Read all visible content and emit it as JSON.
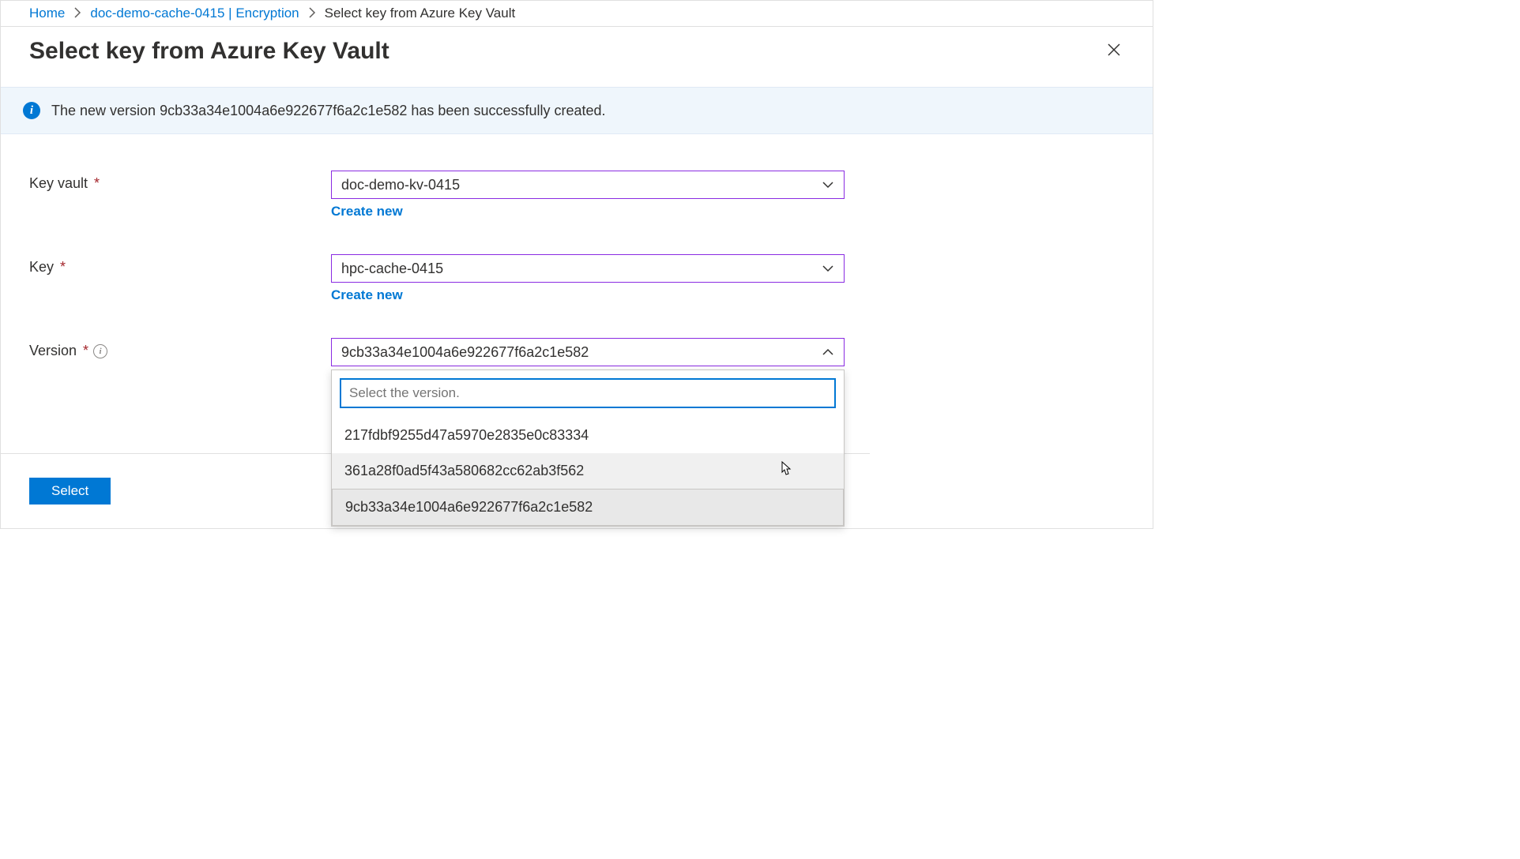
{
  "breadcrumb": {
    "home": "Home",
    "parent": "doc-demo-cache-0415 | Encryption",
    "current": "Select key from Azure Key Vault"
  },
  "page_title": "Select key from Azure Key Vault",
  "info_message": "The new version 9cb33a34e1004a6e922677f6a2c1e582 has been successfully created.",
  "fields": {
    "key_vault": {
      "label": "Key vault",
      "value": "doc-demo-kv-0415",
      "create_link": "Create new"
    },
    "key": {
      "label": "Key",
      "value": "hpc-cache-0415",
      "create_link": "Create new"
    },
    "version": {
      "label": "Version",
      "value": "9cb33a34e1004a6e922677f6a2c1e582",
      "search_placeholder": "Select the version.",
      "options": [
        "217fdbf9255d47a5970e2835e0c83334",
        "361a28f0ad5f43a580682cc62ab3f562",
        "9cb33a34e1004a6e922677f6a2c1e582"
      ]
    }
  },
  "footer": {
    "select_button": "Select"
  }
}
